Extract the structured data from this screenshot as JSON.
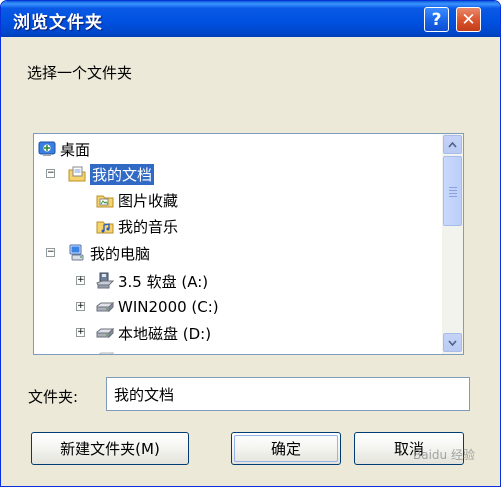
{
  "window": {
    "title": "浏览文件夹"
  },
  "title_buttons": {
    "help": "?",
    "close": "✕"
  },
  "prompt": "选择一个文件夹",
  "tree": {
    "items": [
      {
        "label": "桌面",
        "icon": "desktop-icon",
        "level": 0,
        "expander": ""
      },
      {
        "label": "我的文档",
        "icon": "my-documents-icon",
        "level": 1,
        "expander": "−",
        "selected": true
      },
      {
        "label": "图片收藏",
        "icon": "pictures-folder-icon",
        "level": 2,
        "expander": ""
      },
      {
        "label": "我的音乐",
        "icon": "music-folder-icon",
        "level": 2,
        "expander": ""
      },
      {
        "label": "我的电脑",
        "icon": "my-computer-icon",
        "level": 1,
        "expander": "−"
      },
      {
        "label": "3.5 软盘 (A:)",
        "icon": "floppy-drive-icon",
        "level": 2,
        "expander": "+"
      },
      {
        "label": "WIN2000 (C:)",
        "icon": "hard-drive-icon",
        "level": 2,
        "expander": "+"
      },
      {
        "label": "本地磁盘 (D:)",
        "icon": "hard-drive-icon",
        "level": 2,
        "expander": "+"
      }
    ]
  },
  "folder_field": {
    "label": "文件夹:",
    "value": "我的文档"
  },
  "buttons": {
    "new_folder": "新建文件夹(M)",
    "ok": "确定",
    "cancel": "取消"
  },
  "watermark": "Baidu 经验",
  "colors": {
    "title_bar": "#0050e0",
    "selection": "#316ac5",
    "dialog_bg": "#ece9d8"
  }
}
